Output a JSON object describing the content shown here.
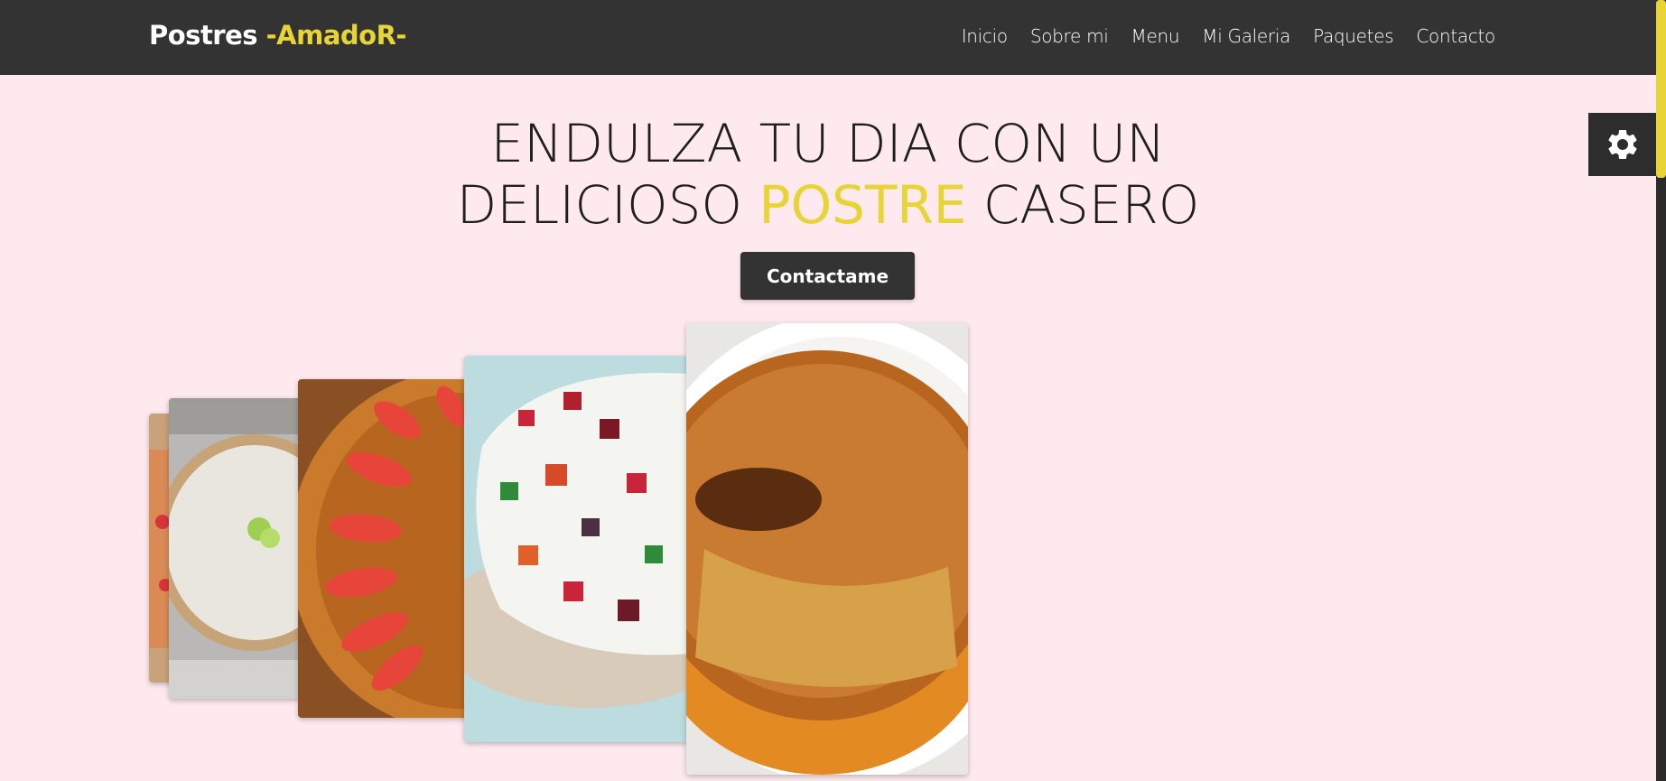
{
  "brand": {
    "prefix": "Postres ",
    "accent": "-AmadoR-"
  },
  "nav": [
    "Inicio",
    "Sobre mi",
    "Menu",
    "Mi Galeria",
    "Paquetes",
    "Contacto"
  ],
  "hero": {
    "line1": "ENDULZA TU DIA CON UN",
    "line2_a": "DELICIOSO ",
    "line2_accent": "POSTRE",
    "line2_b": " CASERO",
    "button": "Contactame"
  },
  "gallery": [
    {
      "name": "strawberry-pie-card"
    },
    {
      "name": "lime-pie-card"
    },
    {
      "name": "strawberry-jelly-card"
    },
    {
      "name": "mosaic-gelatin-card"
    },
    {
      "name": "flan-card"
    }
  ],
  "icons": {
    "settings": "gear-icon"
  },
  "colors": {
    "accent": "#e9d436",
    "header": "#333333",
    "background": "#fde9ee"
  }
}
